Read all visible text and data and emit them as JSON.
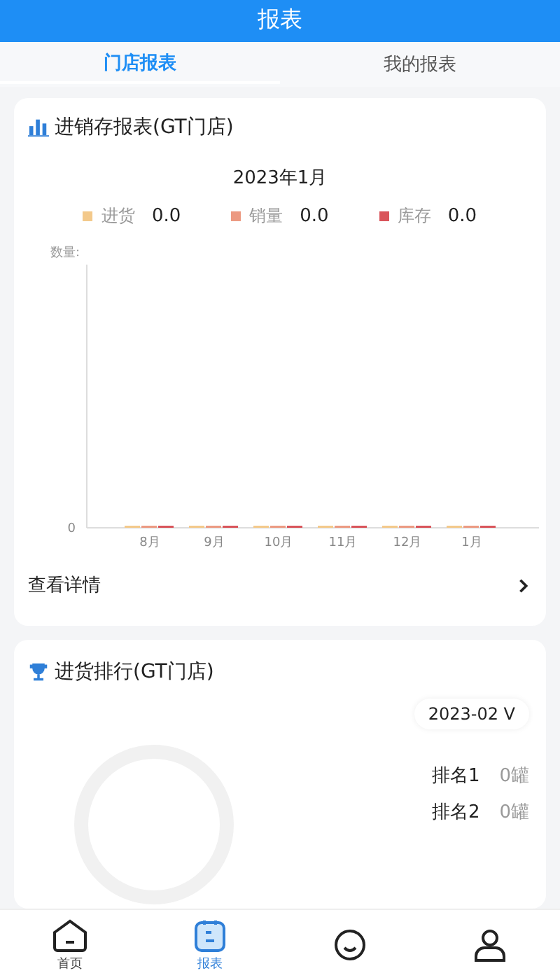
{
  "header": {
    "title": "报表"
  },
  "tabs": [
    {
      "label": "门店报表",
      "selected": true
    },
    {
      "label": "我的报表",
      "selected": false
    }
  ],
  "inventory_card": {
    "title": "进销存报表(GT门店)",
    "period": "2023年1月",
    "legend": [
      {
        "label": "进货",
        "value": "0.0",
        "color": "#f3c98b"
      },
      {
        "label": "销量",
        "value": "0.0",
        "color": "#ec9a82"
      },
      {
        "label": "库存",
        "value": "0.0",
        "color": "#d9545a"
      }
    ],
    "chart": {
      "axis_label": "数量:",
      "zero_tick": "0",
      "months": [
        "8月",
        "9月",
        "10月",
        "11月",
        "12月",
        "1月"
      ]
    },
    "details_link": "查看详情"
  },
  "ranking_card": {
    "title": "进货排行(GT门店)",
    "month": "2023-02 V",
    "rows": [
      {
        "label": "排名1",
        "value": "0罐"
      },
      {
        "label": "排名2",
        "value": "0罐"
      }
    ]
  },
  "nav": [
    {
      "kind": "home",
      "label": "首页",
      "selected": false
    },
    {
      "kind": "report",
      "label": "报表",
      "selected": true
    },
    {
      "kind": "face",
      "selected": false
    },
    {
      "kind": "person",
      "selected": false
    }
  ]
}
